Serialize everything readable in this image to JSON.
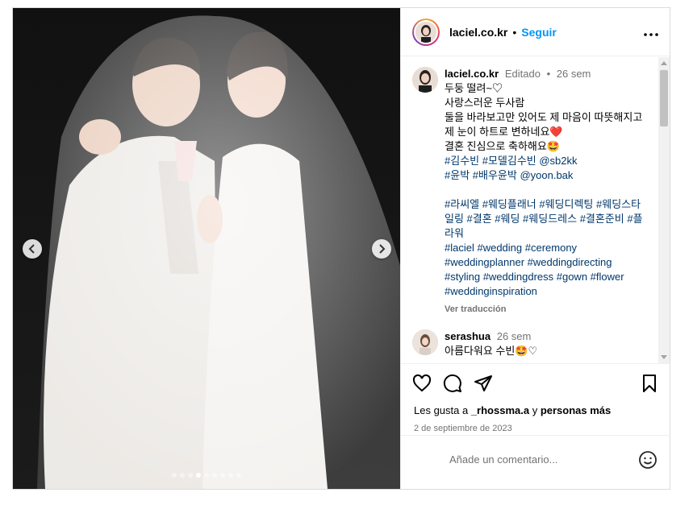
{
  "header": {
    "username": "laciel.co.kr",
    "separator": "•",
    "follow_label": "Seguir",
    "more_icon": "more-dots-icon"
  },
  "caption": {
    "username": "laciel.co.kr",
    "edited": "Editado",
    "bullet": "•",
    "time": "26 sem",
    "lines": [
      "두둥 떨려~♡",
      "사랑스러운 두사람",
      "둘을 바라보고만 있어도 제 마음이 따뜻해지고",
      "제 눈이 하트로 변하네요❤️",
      "결혼 진심으로 축하해요🤩"
    ],
    "tags_1": "#김수빈 #모델김수빈 @sb2kk",
    "tags_2": "#윤박 #배우윤박 @yoon.bak",
    "tags_3": "#라씨엘 #웨딩플래너 #웨딩디렉팅 #웨딩스타일링 #결혼 #웨딩 #웨딩드레스 #결혼준비 #플라워",
    "tags_4": "#laciel #wedding #ceremony #weddingplanner #weddingdirecting #styling #weddingdress #gown #flower #weddinginspiration",
    "translate": "Ver traducción"
  },
  "comment": {
    "username": "serashua",
    "time": "26 sem",
    "text": "아름다워요 수빈🤩♡"
  },
  "likes": {
    "prefix": "Les gusta a ",
    "user": "_rhossma.a",
    "middle": " y ",
    "others": "personas más"
  },
  "date": "2 de septiembre de 2023",
  "add_comment": {
    "placeholder": "Añade un comentario..."
  },
  "carousel": {
    "count": 9,
    "active": 4
  },
  "colors": {
    "accent": "#0095f6",
    "tag": "#00376b",
    "muted": "#737373"
  }
}
